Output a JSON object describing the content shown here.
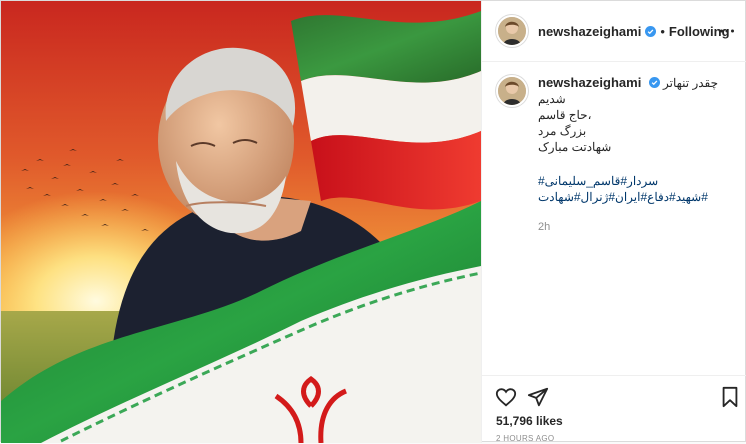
{
  "header": {
    "username": "newshazeighami",
    "follow_label": "Following",
    "separator": "•"
  },
  "caption": {
    "username": "newshazeighami",
    "lines": [
      "چقدر تنهاتر شدیم",
      "،حاج قاسم",
      "بزرگ مرد",
      "شهادتت مبارک"
    ],
    "hashtags": [
      "سردار#قاسم_سلیمانی#",
      "#شهید#دفاع#ایران#ژنرال#شهادت"
    ],
    "relative_time": "2h"
  },
  "footer": {
    "likes": "51,796 likes",
    "time_ago": "2 HOURS AGO"
  },
  "icons": {
    "like": "heart-icon",
    "share": "paper-plane-icon",
    "save": "bookmark-icon",
    "verified": "verified-badge-icon",
    "more": "more-options-icon"
  },
  "colors": {
    "verified": "#3897f0",
    "flag_green": "#239f40",
    "flag_red": "#da0000",
    "hashtag": "#00376b",
    "muted": "#8e8e8e"
  }
}
